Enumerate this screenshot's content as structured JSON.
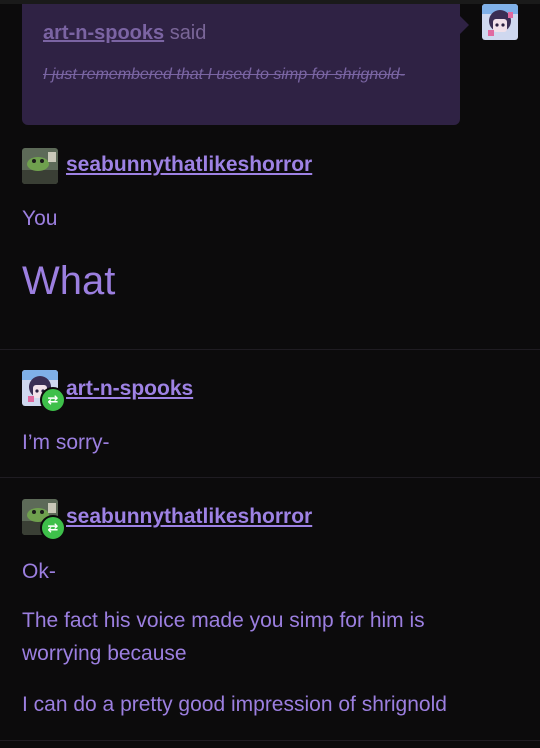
{
  "quote": {
    "username": "art-n-spooks",
    "said": "said",
    "text": "I just remembered that I used to simp for shrignold-"
  },
  "posts": [
    {
      "username": "seabunnythatlikeshorror",
      "lines": [
        "You"
      ],
      "big": "What"
    },
    {
      "username": "art-n-spooks",
      "lines": [
        "I’m sorry-"
      ]
    },
    {
      "username": "seabunnythatlikeshorror",
      "lines": [
        "Ok-",
        "The fact his voice made you simp for him is",
        "worrying because",
        "I can do a pretty good impression of shrignold"
      ]
    }
  ],
  "icons": {
    "reblog": "reblog-icon",
    "avatar_art": "avatar-art-n-spooks",
    "avatar_sea": "avatar-seabunny"
  },
  "colors": {
    "background": "#0c0b0c",
    "accent_text": "#9c7fe0",
    "bubble": "#2f2244",
    "reblog_badge": "#3ec04a"
  }
}
